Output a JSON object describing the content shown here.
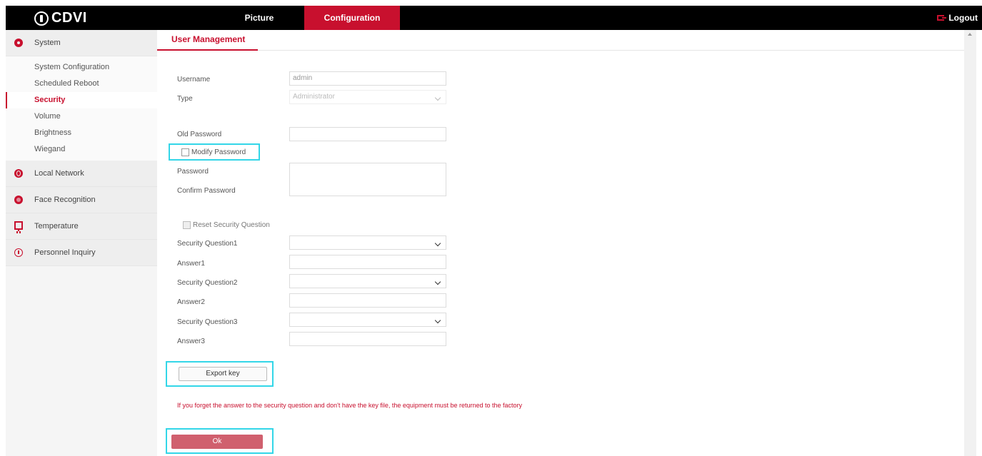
{
  "header": {
    "brand": "CDVI",
    "tabs": [
      {
        "label": "Picture",
        "active": false
      },
      {
        "label": "Configuration",
        "active": true
      }
    ],
    "logout_label": "Logout",
    "colors": {
      "bar": "#000000",
      "accent": "#c8102e"
    }
  },
  "sidebar": {
    "groups": [
      {
        "label": "System",
        "icon": "gear-icon",
        "items": [
          "System Configuration",
          "Scheduled Reboot",
          "Security",
          "Volume",
          "Brightness",
          "Wiegand"
        ],
        "active_item": "Security"
      },
      {
        "label": "Local Network",
        "icon": "globe-icon"
      },
      {
        "label": "Face Recognition",
        "icon": "face-icon"
      },
      {
        "label": "Temperature",
        "icon": "monitor-icon"
      },
      {
        "label": "Personnel Inquiry",
        "icon": "info-icon"
      }
    ]
  },
  "main": {
    "tab_label": "User Management",
    "form": {
      "username_label": "Username",
      "username_value": "admin",
      "type_label": "Type",
      "type_value": "Administrator",
      "old_password_label": "Old Password",
      "old_password_value": "",
      "modify_password_label": "Modify Password",
      "password_label": "Password",
      "confirm_password_label": "Confirm Password",
      "reset_security_question_label": "Reset Security Question",
      "security_question1_label": "Security Question1",
      "answer1_label": "Answer1",
      "security_question2_label": "Security Question2",
      "answer2_label": "Answer2",
      "security_question3_label": "Security Question3",
      "answer3_label": "Answer3",
      "export_key_label": "Export key",
      "warning_text": "If you forget the answer to the security question and don't have the key file, the equipment must be returned to the factory",
      "ok_label": "Ok"
    }
  }
}
